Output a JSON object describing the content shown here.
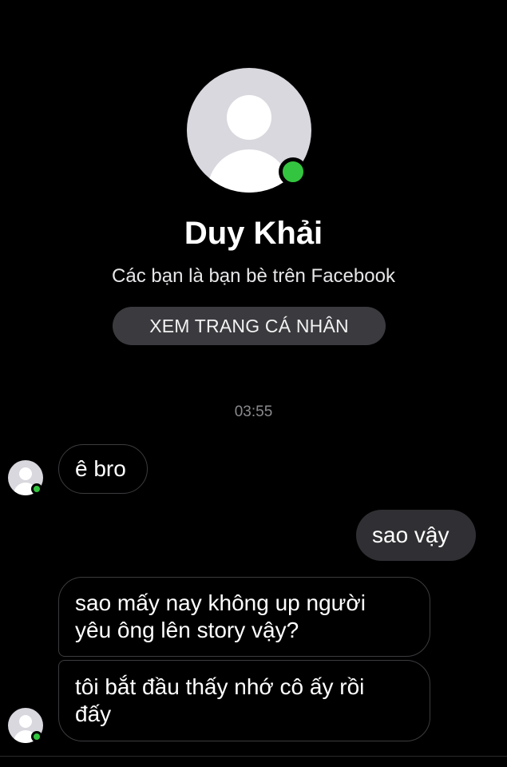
{
  "profile": {
    "name": "Duy Khải",
    "subtitle": "Các bạn là bạn bè trên Facebook",
    "view_profile_label": "XEM TRANG CÁ NHÂN",
    "online_status_color": "#33c53f"
  },
  "conversation": {
    "timestamp": "03:55",
    "messages": [
      {
        "sender": "Duy Khải",
        "direction": "incoming",
        "text": "ê bro"
      },
      {
        "sender": "me",
        "direction": "outgoing",
        "text": "sao vậy"
      },
      {
        "sender": "Duy Khải",
        "direction": "incoming",
        "text": "sao mấy nay không up người\nyêu ông lên story vậy?"
      },
      {
        "sender": "Duy Khải",
        "direction": "incoming",
        "text": "tôi bắt đầu thấy nhớ cô ấy rồi\nđấy"
      }
    ]
  },
  "icons": {
    "profile_avatar": "default-user-avatar-icon",
    "online_indicator": "online-dot-icon"
  },
  "colors": {
    "background": "#000000",
    "outgoing_bubble": "#303034",
    "incoming_bubble_border": "#3c3c40",
    "button_background": "#3b3b3f"
  }
}
